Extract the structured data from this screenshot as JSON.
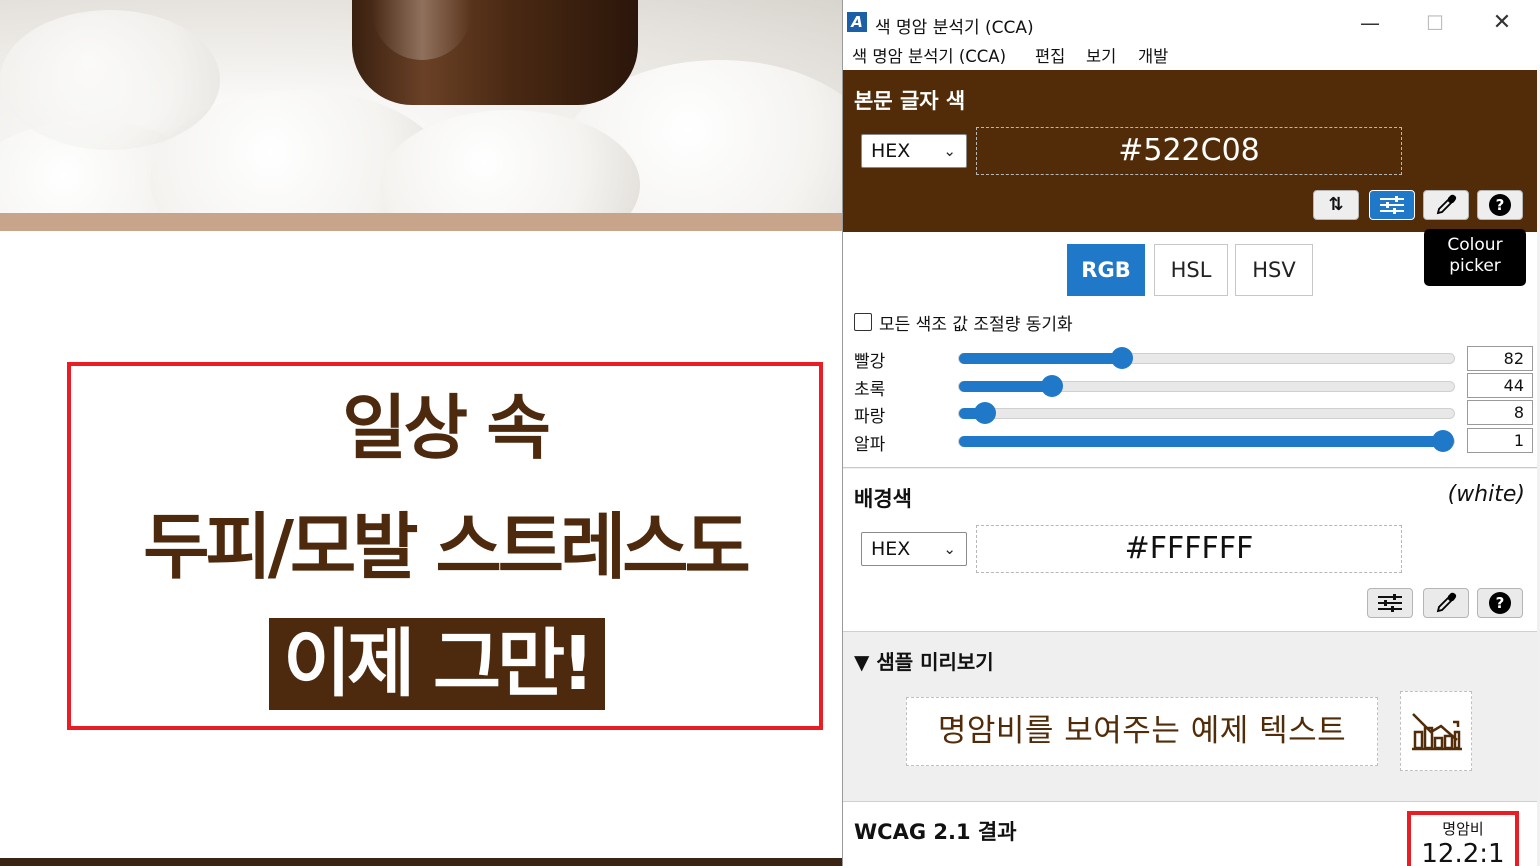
{
  "webpage": {
    "headline_line1": "일상 속",
    "headline_line2": "두피/모발 스트레스도",
    "headline_line3": "이제 그만!"
  },
  "window": {
    "icon_letter": "A",
    "title": "색 명암 분석기 (CCA)",
    "minimize": "—",
    "maximize": "☐",
    "close": "✕"
  },
  "menu": [
    "색 명암 분석기 (CCA)",
    "편집",
    "보기",
    "개발"
  ],
  "foreground": {
    "title": "본문 글자 색",
    "format": "HEX",
    "hex": "#522C08",
    "color": "#522C08",
    "tooltip": "Colour picker",
    "buttons": {
      "swap_icon": "swap-arrows-icon",
      "sliders_icon": "sliders-icon",
      "picker_icon": "eyedropper-icon",
      "help_icon": "help-icon",
      "help_glyph": "?",
      "swap_glyph": "⇅"
    }
  },
  "modes": {
    "tabs": [
      "RGB",
      "HSL",
      "HSV"
    ],
    "active": "RGB"
  },
  "sync": {
    "label": "모든 색조 값 조절량 동기화",
    "checked": false
  },
  "channels": [
    {
      "label": "빨강",
      "value": "82"
    },
    {
      "label": "초록",
      "value": "44"
    },
    {
      "label": "파랑",
      "value": "8"
    },
    {
      "label": "알파",
      "value": "1"
    }
  ],
  "channel_levels": [
    0.3216,
    0.1725,
    0.0314,
    1.0
  ],
  "background": {
    "title": "배경색",
    "name": "(white)",
    "format": "HEX",
    "hex": "#FFFFFF",
    "color": "#FFFFFF"
  },
  "preview": {
    "title": "▼ 샘플 미리보기",
    "sample_text": "명암비를 보여주는 예제 텍스트",
    "chart_icon": "bar-chart-icon"
  },
  "wcag": {
    "title": "WCAG 2.1 결과",
    "ratio_label": "명암비",
    "ratio_value": "12.2:1"
  },
  "colors": {
    "accent": "#1F78C8",
    "highlight": "#EA1C24",
    "brand_brown": "#4D2A0E"
  }
}
